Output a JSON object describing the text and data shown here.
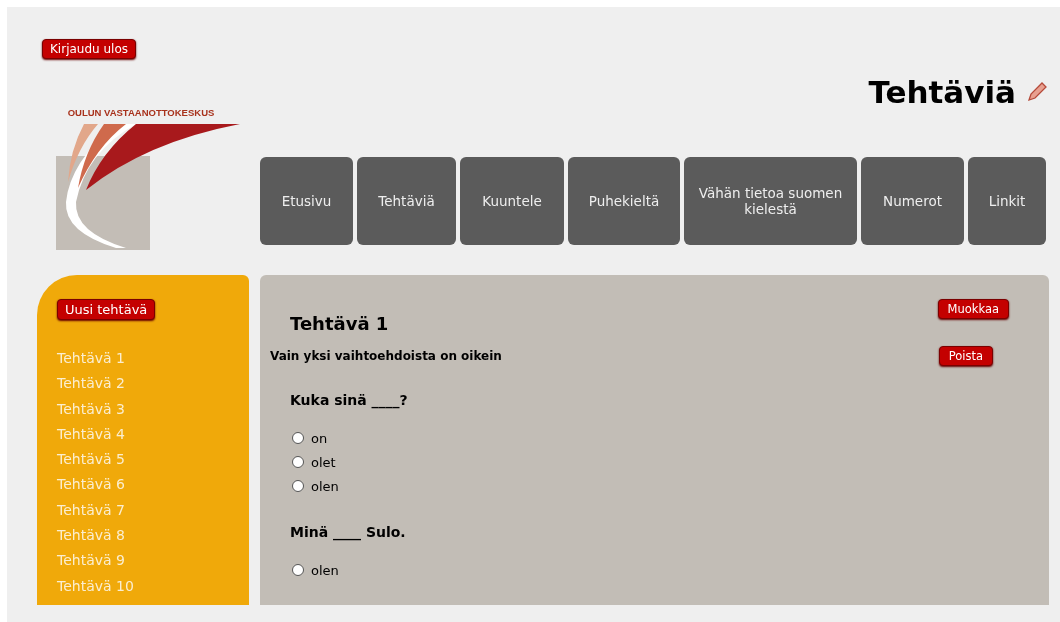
{
  "logout_button": "Kirjaudu ulos",
  "logo": {
    "text": "OULUN VASTAANOTTOKESKUS"
  },
  "page_title": "Tehtäviä",
  "nav": [
    {
      "label": "Etusivu"
    },
    {
      "label": "Tehtäviä"
    },
    {
      "label": "Kuuntele"
    },
    {
      "label": "Puhekieltä"
    },
    {
      "label": "Vähän tietoa suomen kielestä"
    },
    {
      "label": "Numerot"
    },
    {
      "label": "Linkit"
    }
  ],
  "sidebar": {
    "new_button": "Uusi tehtävä",
    "items": [
      "Tehtävä 1",
      "Tehtävä 2",
      "Tehtävä 3",
      "Tehtävä 4",
      "Tehtävä 5",
      "Tehtävä 6",
      "Tehtävä 7",
      "Tehtävä 8",
      "Tehtävä 9",
      "Tehtävä 10"
    ]
  },
  "exercise": {
    "title": "Tehtävä 1",
    "edit_button": "Muokkaa",
    "delete_button": "Poista",
    "instruction": "Vain yksi vaihtoehdoista on oikein",
    "questions": [
      {
        "text": "Kuka sinä ____?",
        "options": [
          {
            "label": "on",
            "selected": false
          },
          {
            "label": "olet",
            "selected": false
          },
          {
            "label": "olen",
            "selected": false
          }
        ]
      },
      {
        "text": "Minä ____ Sulo.",
        "options": [
          {
            "label": "olen",
            "selected": false
          }
        ]
      }
    ]
  }
}
